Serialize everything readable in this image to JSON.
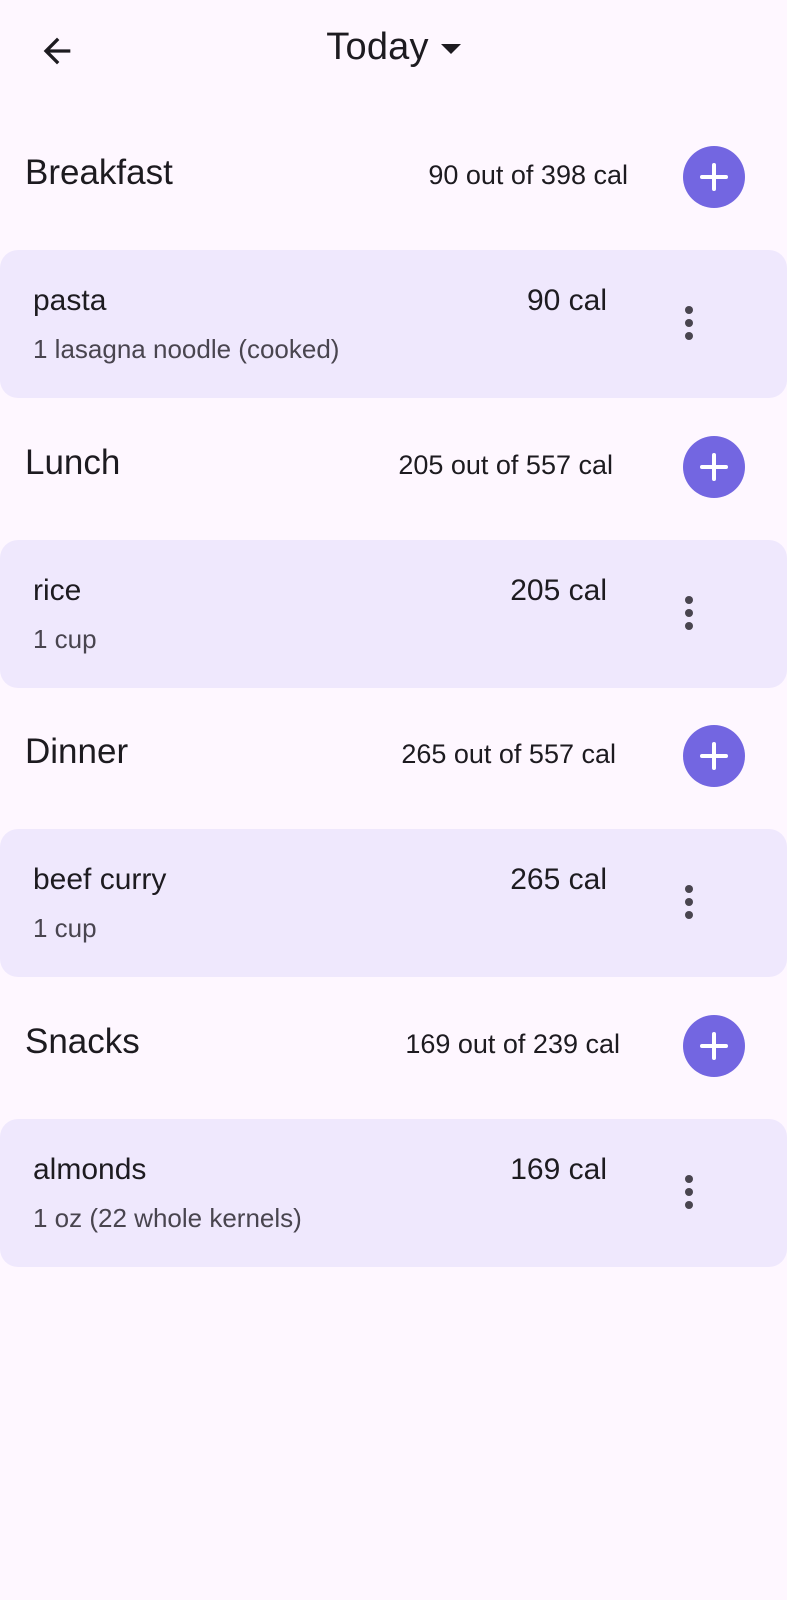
{
  "app_bar": {
    "back_icon": "arrow-back-icon",
    "title": "Today",
    "dropdown_icon": "arrow-drop-down-icon"
  },
  "colors": {
    "background": "#FEF7FF",
    "card": "#EFE8FD",
    "accent": "#7366E1"
  },
  "meals": [
    {
      "title": "Breakfast",
      "summary": "90 out of 398 cal",
      "add_icon": "plus-icon",
      "items": [
        {
          "name": "pasta",
          "serving": "1 lasagna noodle (cooked)",
          "calories": "90 cal",
          "menu_icon": "more-vert-icon"
        }
      ]
    },
    {
      "title": "Lunch",
      "summary": "205 out of 557 cal",
      "add_icon": "plus-icon",
      "items": [
        {
          "name": "rice",
          "serving": "1 cup",
          "calories": "205 cal",
          "menu_icon": "more-vert-icon"
        }
      ]
    },
    {
      "title": "Dinner",
      "summary": "265 out of 557 cal",
      "add_icon": "plus-icon",
      "items": [
        {
          "name": "beef curry",
          "serving": "1 cup",
          "calories": "265 cal",
          "menu_icon": "more-vert-icon"
        }
      ]
    },
    {
      "title": "Snacks",
      "summary": "169 out of 239 cal",
      "add_icon": "plus-icon",
      "items": [
        {
          "name": "almonds",
          "serving": "1 oz (22 whole kernels)",
          "calories": "169 cal",
          "menu_icon": "more-vert-icon"
        }
      ]
    }
  ]
}
